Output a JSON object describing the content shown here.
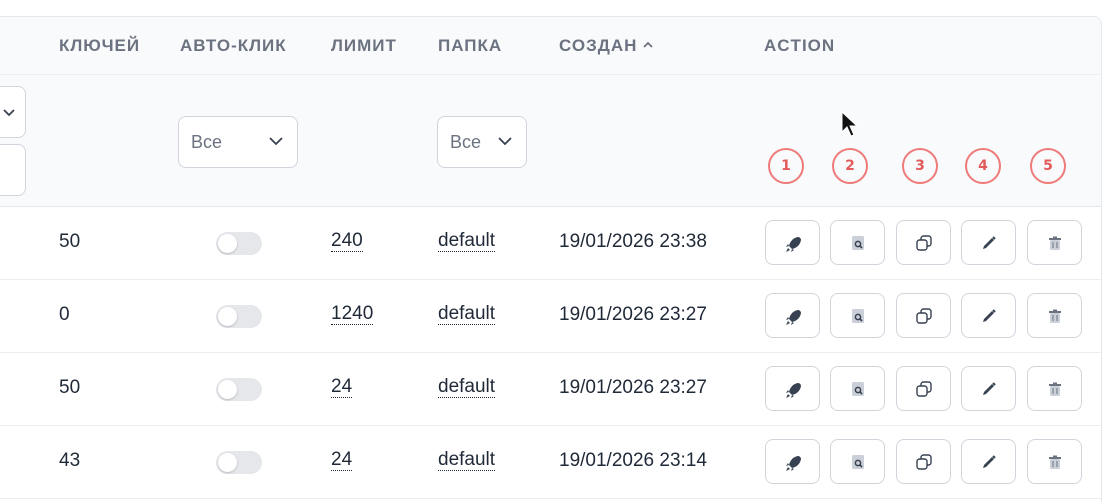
{
  "columns": {
    "keys": "КЛЮЧЕЙ",
    "autoclick": "АВТО-КЛИК",
    "limit": "ЛИМИТ",
    "folder": "ПАПКА",
    "created": "СОЗДАН",
    "action": "ACTION"
  },
  "filters": {
    "autoclick_value": "Все",
    "folder_value": "Все"
  },
  "annotations": [
    "1",
    "2",
    "3",
    "4",
    "5"
  ],
  "rows": [
    {
      "keys": "50",
      "autoclick": false,
      "limit": "240",
      "folder": "default",
      "created": "19/01/2026 23:38"
    },
    {
      "keys": "0",
      "autoclick": false,
      "limit": "1240",
      "folder": "default",
      "created": "19/01/2026 23:27"
    },
    {
      "keys": "50",
      "autoclick": false,
      "limit": "24",
      "folder": "default",
      "created": "19/01/2026 23:27"
    },
    {
      "keys": "43",
      "autoclick": false,
      "limit": "24",
      "folder": "default",
      "created": "19/01/2026 23:14"
    }
  ],
  "action_icons": [
    "rocket-icon",
    "file-search-icon",
    "copy-icon",
    "pencil-icon",
    "trash-icon"
  ],
  "colors": {
    "annotation": "#ef7a7a",
    "header_bg": "#f9fafb",
    "toggle_off": "#e5e7eb"
  }
}
